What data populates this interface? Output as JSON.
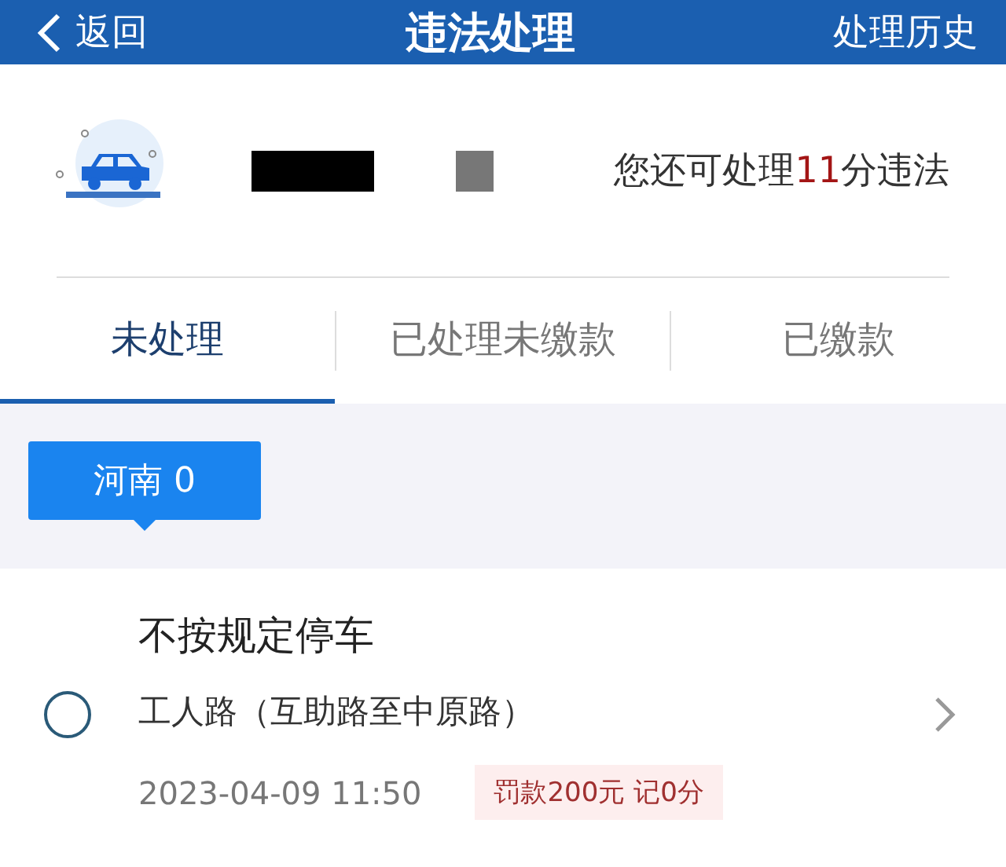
{
  "header": {
    "back": "返回",
    "title": "违法处理",
    "history": "处理历史"
  },
  "vehicle": {
    "quota_before": "您还可处理",
    "quota_points": "11",
    "quota_after": "分违法"
  },
  "tabs": [
    {
      "label": "未处理",
      "selected": true
    },
    {
      "label": "已处理未缴款",
      "selected": false
    },
    {
      "label": "已缴款",
      "selected": false
    }
  ],
  "region_tag": "河南 0",
  "violations": [
    {
      "title": "不按规定停车",
      "location": "工人路（互助路至中原路）",
      "time": "2023-04-09 11:50",
      "penalty": "罚款200元 记0分",
      "checked": false
    }
  ]
}
